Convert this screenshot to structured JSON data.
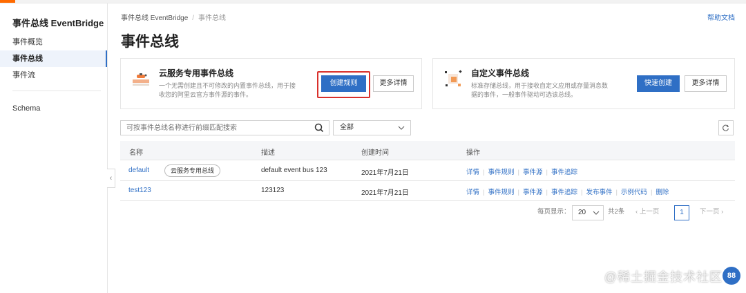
{
  "sidebar": {
    "title": "事件总线 EventBridge",
    "items": [
      {
        "label": "事件概览"
      },
      {
        "label": "事件总线"
      },
      {
        "label": "事件流"
      },
      {
        "label": "Schema"
      }
    ]
  },
  "breadcrumb": {
    "root": "事件总线 EventBridge",
    "current": "事件总线"
  },
  "help_label": "帮助文档",
  "page_title": "事件总线",
  "cards": [
    {
      "title": "云服务专用事件总线",
      "desc": "一个无需创建且不可修改的内置事件总线，用于接收您的阿里云官方事件源的事件。",
      "primary_label": "创建规则",
      "secondary_label": "更多详情"
    },
    {
      "title": "自定义事件总线",
      "desc": "标准存储总线，用于接收自定义应用或存量消息数据的事件，一般事件驱动可选该总线。",
      "primary_label": "快速创建",
      "secondary_label": "更多详情"
    }
  ],
  "search": {
    "placeholder": "可按事件总线名称进行前缀匹配搜索",
    "value": ""
  },
  "filter": {
    "selected": "全部"
  },
  "table": {
    "columns": [
      "名称",
      "描述",
      "创建时间",
      "操作"
    ],
    "rows": [
      {
        "name": "default",
        "tag": "云服务专用总线",
        "desc": "default event bus 123",
        "created": "2021年7月21日",
        "ops": [
          "详情",
          "事件规则",
          "事件源",
          "事件追踪"
        ]
      },
      {
        "name": "test123",
        "tag": "",
        "desc": "123123",
        "created": "2021年7月21日",
        "ops": [
          "详情",
          "事件规则",
          "事件源",
          "事件追踪",
          "发布事件",
          "示例代码",
          "删除"
        ]
      }
    ]
  },
  "pagination": {
    "page_size_label": "每页显示：",
    "page_size": "20",
    "total": "共2条",
    "prev": "上一页",
    "current": "1",
    "next": "下一页"
  },
  "watermark": {
    "text": "@稀土掘金技术社区"
  },
  "colors": {
    "primary": "#2f6fc5",
    "accent": "#ff6a00",
    "highlight": "#d9302b"
  }
}
